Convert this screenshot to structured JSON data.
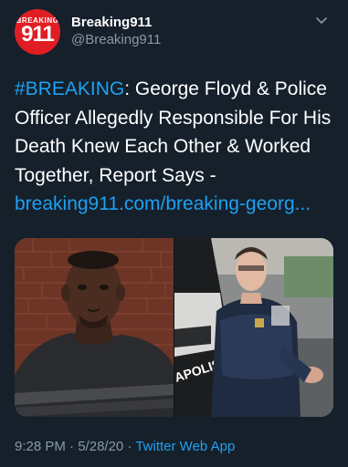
{
  "account": {
    "avatar_top_text": "BREAKING",
    "avatar_number": "911",
    "display_name": "Breaking911",
    "handle": "@Breaking911"
  },
  "tweet": {
    "hashtag": "#BREAKING",
    "body": ": George Floyd & Police Officer Allegedly Responsible For His Death Knew Each Other & Worked Together, Report Says -",
    "link": "breaking911.com/breaking-georg..."
  },
  "media": {
    "right_sign_text": "APOLIS"
  },
  "meta": {
    "time": "9:28 PM",
    "separator": "·",
    "date": "5/28/20",
    "client": "Twitter Web App"
  },
  "colors": {
    "background": "#15202b",
    "accent": "#1da1f2",
    "secondary_text": "#8899a6",
    "brand_red": "#e11d24"
  },
  "icons": {
    "more": "chevron-down-icon"
  }
}
